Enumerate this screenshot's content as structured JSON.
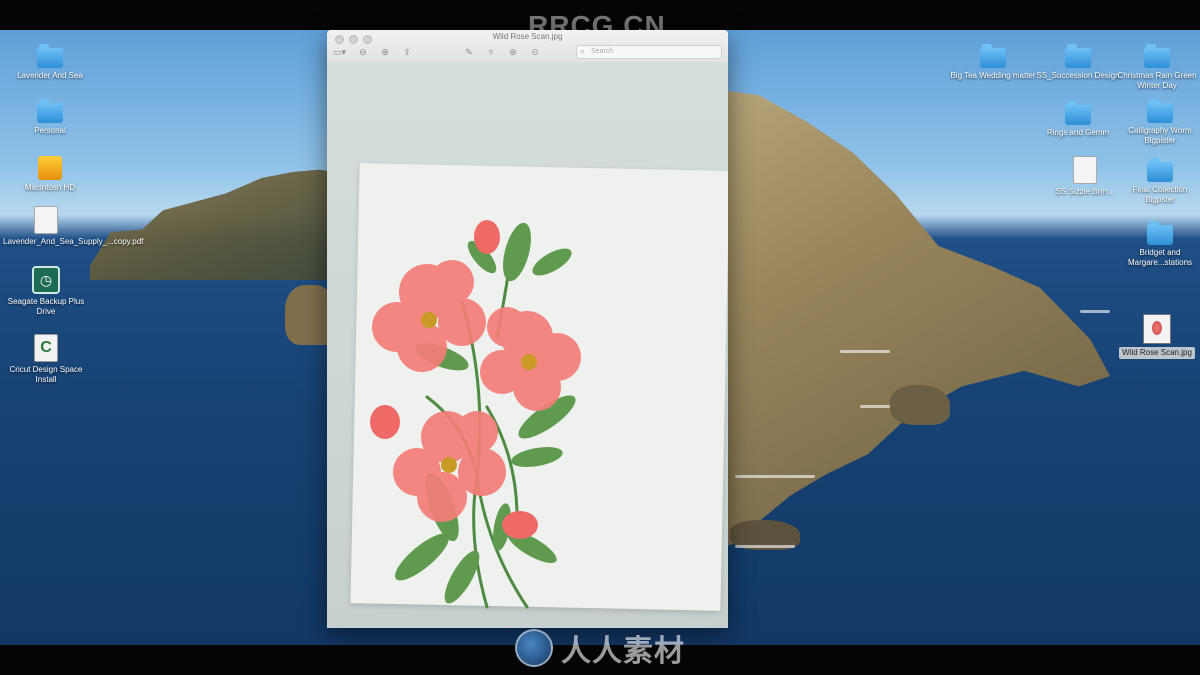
{
  "watermarks": {
    "top": "RRCG.CN",
    "bottom": "人人素材"
  },
  "window": {
    "title": "Wild Rose Scan.jpg",
    "search_placeholder": "Search",
    "tools": [
      "▭▾",
      "⊖",
      "⊕",
      "⇪",
      "✎",
      "▿",
      "⊚",
      "⊙"
    ]
  },
  "desktop": {
    "left_icons": [
      {
        "label": "Lavender And Sea",
        "type": "folder"
      },
      {
        "label": "Personal",
        "type": "folder"
      },
      {
        "label": "Macintosh HD",
        "type": "drive"
      },
      {
        "label": "Lavender_And_Sea_Supply_...copy.pdf",
        "type": "doc"
      },
      {
        "label": "Seagate Backup Plus Drive",
        "type": "backup"
      },
      {
        "label": "Cricut Design Space Install",
        "type": "cricut"
      }
    ],
    "right_icons": [
      {
        "label": "Big Tea Wedding matter",
        "type": "folder"
      },
      {
        "label": "SS_Succession Design",
        "type": "folder"
      },
      {
        "label": "Christmas Rain Green Winter Day",
        "type": "folder"
      },
      {
        "label": "Rings and Gemm",
        "type": "folder"
      },
      {
        "label": "Calligraphy Worm Bigpister",
        "type": "folder"
      },
      {
        "label": "SS Sizzle Brrrr...",
        "type": "doc"
      },
      {
        "label": "Final Collection Bigpster",
        "type": "folder"
      },
      {
        "label": "Bridget and Margare...stations",
        "type": "folder"
      },
      {
        "label": "Wild Rose Scan.jpg",
        "type": "thumb"
      }
    ]
  },
  "colors": {
    "flower": "#f47d78",
    "leaf": "#5f9a4f",
    "paper": "#eef1ee"
  }
}
